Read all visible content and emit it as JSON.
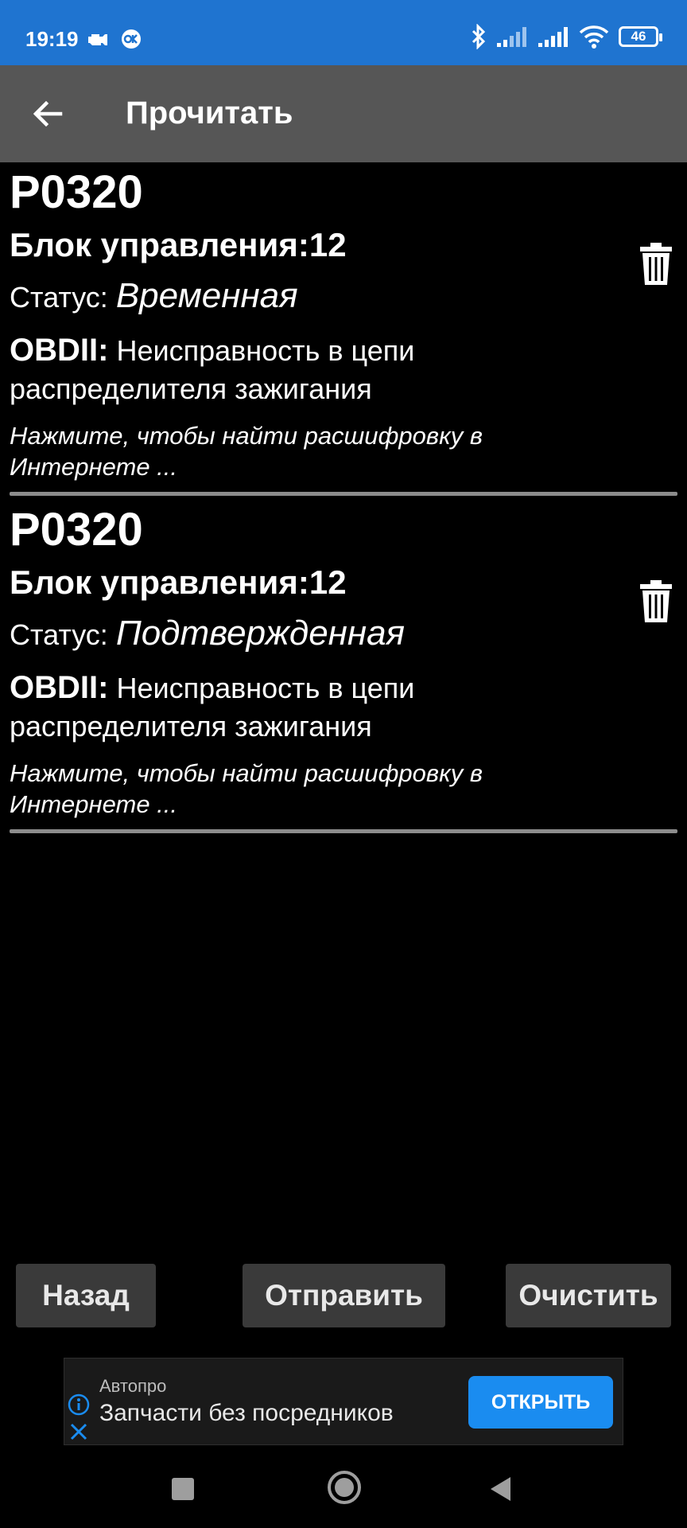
{
  "status_bar": {
    "time": "19:19",
    "battery": "46",
    "color": "#1f74d0"
  },
  "app_bar": {
    "title": "Прочитать",
    "back_icon": "arrow-left-icon",
    "color": "#565656"
  },
  "errors": [
    {
      "code": "P0320",
      "block_label": "Блок управления:",
      "block_value": "12",
      "status_label": "Статус:",
      "status_value": "Временная",
      "obd_label": "OBDII:",
      "obd_text": "Неисправность в цепи распределителя зажигания",
      "hint": "Нажмите, чтобы найти расшифровку в Интернете ..."
    },
    {
      "code": "P0320",
      "block_label": "Блок управления:",
      "block_value": "12",
      "status_label": "Статус:",
      "status_value": "Подтвержденная",
      "obd_label": "OBDII:",
      "obd_text": "Неисправность в цепи распределителя зажигания",
      "hint": "Нажмите, чтобы найти расшифровку в Интернете ..."
    }
  ],
  "buttons": {
    "back": "Назад",
    "send": "Отправить",
    "clear": "Очистить"
  },
  "ad": {
    "source": "Автопро",
    "text": "Запчасти без посредников",
    "open": "ОТКРЫТЬ",
    "accent": "#1a8cf0"
  }
}
